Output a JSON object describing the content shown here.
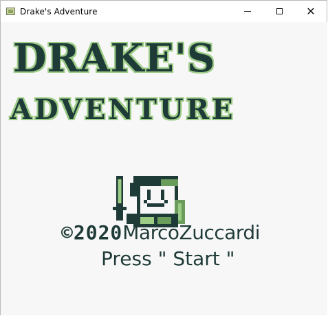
{
  "window": {
    "title": "Drake's Adventure",
    "controls": {
      "minimize": "",
      "maximize": "",
      "close": "✕"
    }
  },
  "game": {
    "logo_line1": "DRAKE'S",
    "logo_line2": "ADVENTURE",
    "copyright_symbol_year": "©2020",
    "copyright_author": "MarcoZuccardi",
    "prompt": "Press \" Start \""
  },
  "colors": {
    "dark": "#1f3b38",
    "mid": "#6a9c5c",
    "light": "#9ccc86",
    "background": "#f7f7f7"
  }
}
